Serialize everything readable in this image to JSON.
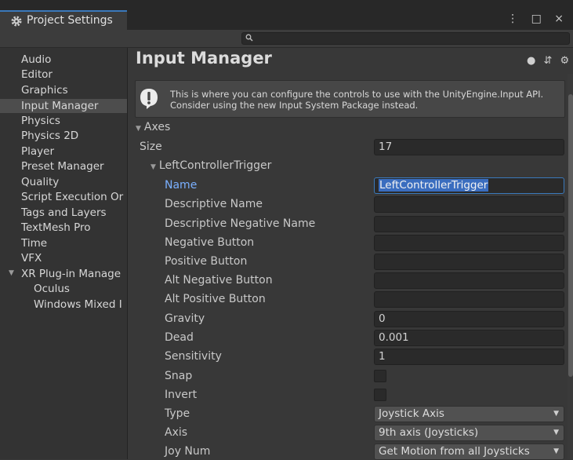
{
  "window": {
    "tab_title": "Project Settings",
    "controls": "⋮ □ ×"
  },
  "search": {
    "placeholder": ""
  },
  "sidebar": {
    "items": [
      {
        "label": "Audio"
      },
      {
        "label": "Editor"
      },
      {
        "label": "Graphics"
      },
      {
        "label": "Input Manager",
        "selected": true
      },
      {
        "label": "Physics"
      },
      {
        "label": "Physics 2D"
      },
      {
        "label": "Player"
      },
      {
        "label": "Preset Manager"
      },
      {
        "label": "Quality"
      },
      {
        "label": "Script Execution Or"
      },
      {
        "label": "Tags and Layers"
      },
      {
        "label": "TextMesh Pro"
      },
      {
        "label": "Time"
      },
      {
        "label": "VFX"
      },
      {
        "label": "XR Plug-in Manage"
      },
      {
        "label": "Oculus"
      },
      {
        "label": "Windows Mixed I"
      }
    ]
  },
  "main": {
    "title": "Input Manager",
    "header_icons": "❓ ⇅ ⚙",
    "help": "This is where you can configure the controls to use with the UnityEngine.Input API. Consider using the new Input System Package instead.",
    "axes_label": "Axes",
    "size_label": "Size",
    "size_value": "17",
    "axis_name": "LeftControllerTrigger",
    "fields": {
      "name_label": "Name",
      "name_value": "LeftControllerTrigger",
      "descriptive_name": "Descriptive Name",
      "descriptive_negative_name": "Descriptive Negative Name",
      "negative_button": "Negative Button",
      "positive_button": "Positive Button",
      "alt_negative_button": "Alt Negative Button",
      "alt_positive_button": "Alt Positive Button",
      "gravity_label": "Gravity",
      "gravity_value": "0",
      "dead_label": "Dead",
      "dead_value": "0.001",
      "sensitivity_label": "Sensitivity",
      "sensitivity_value": "1",
      "snap_label": "Snap",
      "invert_label": "Invert",
      "type_label": "Type",
      "type_value": "Joystick Axis",
      "axis_label": "Axis",
      "axis_value": "9th axis (Joysticks)",
      "joynum_label": "Joy Num",
      "joynum_value": "Get Motion from all Joysticks"
    }
  },
  "colors": {
    "accent": "#3a79bb",
    "selection": "#3a6dbf",
    "active_label": "#7ab0ff"
  }
}
